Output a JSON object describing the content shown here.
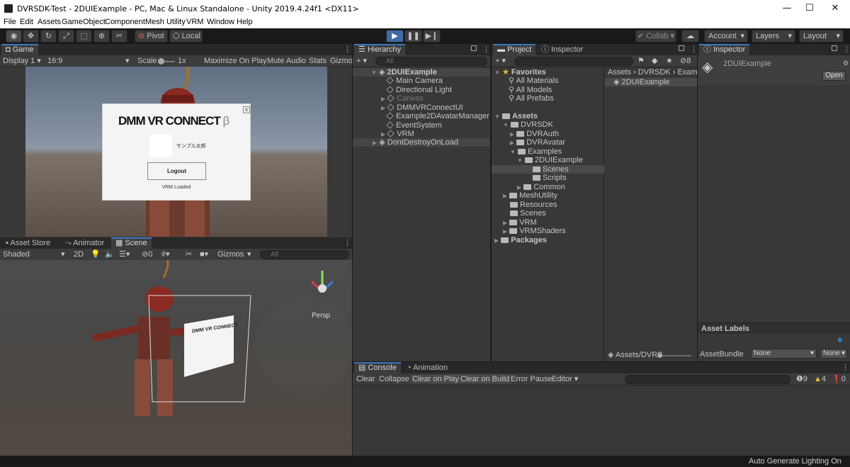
{
  "window": {
    "title": "DVRSDK-Test - 2DUIExample - PC, Mac & Linux Standalone - Unity 2019.4.24f1 <DX11>",
    "min": "—",
    "max": "☐",
    "close": "✕"
  },
  "menu": [
    "File",
    "Edit",
    "Assets",
    "GameObject",
    "Component",
    "Mesh Utility",
    "VRM",
    "Window",
    "Help"
  ],
  "toolbar": {
    "pivot": "Pivot",
    "local": "Local",
    "collab": "Collab",
    "account": "Account",
    "layers": "Layers",
    "layout": "Layout"
  },
  "game": {
    "tab": "Game",
    "display": "Display 1",
    "aspect": "16:9",
    "scale_label": "Scale",
    "scale_value": "1x",
    "maximize": "Maximize On Play",
    "mute": "Mute Audio",
    "stats": "Stats",
    "gizmos": "Gizmos"
  },
  "dialog": {
    "logo": "DMM VR CONNECT",
    "beta": "β",
    "close": "x",
    "username": "サンプル太郎",
    "logout": "Logout",
    "status": "VRM Loaded"
  },
  "scene": {
    "tabs": [
      "Asset Store",
      "Animator",
      "Scene"
    ],
    "shading": "Shaded",
    "mode2d": "2D",
    "hidden_count": "0",
    "gizmos": "Gizmos",
    "search_placeholder": "All",
    "persp": "Persp",
    "billboard_logo": "DMM VR CONNECT"
  },
  "hierarchy": {
    "tab": "Hierarchy",
    "search_placeholder": "All",
    "root": "2DUIExample",
    "items": [
      "Main Camera",
      "Directional Light",
      "Canvas",
      "DMMVRConnectUI",
      "Example2DAvatarManager",
      "EventSystem",
      "VRM"
    ],
    "dontdestroy": "DontDestroyOnLoad"
  },
  "project": {
    "tabs": [
      "Project",
      "Inspector"
    ],
    "hidden_count": "8",
    "favorites": "Favorites",
    "fav_items": [
      "All Materials",
      "All Models",
      "All Prefabs"
    ],
    "assets": "Assets",
    "tree": [
      "DVRSDK",
      "DVRAuth",
      "DVRAvatar",
      "Examples",
      "2DUIExample",
      "Scenes",
      "Scripts",
      "Common",
      "MeshUtility",
      "Resources",
      "Scenes",
      "VRM",
      "VRMShaders"
    ],
    "packages": "Packages",
    "breadcrumb": [
      "Assets",
      "DVRSDK",
      "Examp"
    ],
    "file": "2DUIExample",
    "bottom_path": "Assets/DVRS"
  },
  "inspector": {
    "tab": "Inspector",
    "name": "2DUIExample",
    "open": "Open",
    "asset_labels": "Asset Labels",
    "bundle_label": "AssetBundle",
    "bundle_value": "None",
    "variant_value": "None"
  },
  "console": {
    "tabs": [
      "Console",
      "Animation"
    ],
    "clear": "Clear",
    "collapse": "Collapse",
    "clear_on_play": "Clear on Play",
    "clear_on_build": "Clear on Build",
    "error_pause": "Error Pause",
    "editor": "Editor",
    "logs": "9",
    "warnings": "4",
    "errors": "0"
  },
  "status": {
    "text": "Auto Generate Lighting On"
  }
}
